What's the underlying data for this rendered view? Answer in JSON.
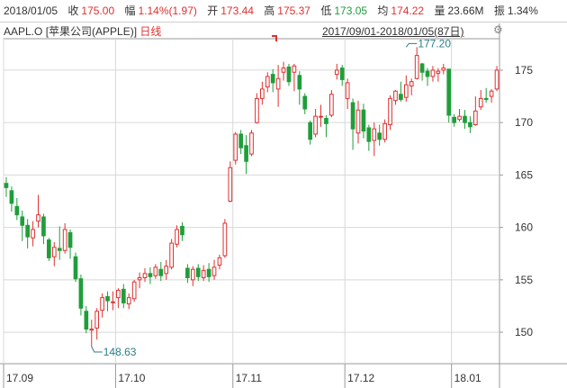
{
  "quote": {
    "date": "2018/01/05",
    "close_label": "收",
    "close": "175.00",
    "change_label": "幅",
    "change": "1.14%(1.97)",
    "open_label": "开",
    "open": "173.44",
    "high_label": "高",
    "high": "175.37",
    "low_label": "低",
    "low": "173.05",
    "avg_label": "均",
    "avg": "174.22",
    "volume_label": "量",
    "volume": "23.66M",
    "amplitude_label": "振",
    "amplitude": "1.34%"
  },
  "header": {
    "symbol": "AAPL.O [苹果公司(APPLE)]",
    "kind": "日线",
    "range": "2017/09/01-2018/01/05(87日)"
  },
  "colors": {
    "up": "#e03030",
    "down": "#1e9e3a",
    "grid": "#d8d8d8",
    "axis": "#999999",
    "annotation": "#2a7d8a"
  },
  "chart_data": {
    "type": "candlestick",
    "ylim": [
      147,
      178
    ],
    "yticks": [
      150,
      155,
      160,
      165,
      170,
      175
    ],
    "xticks": [
      {
        "label": "17.09",
        "index": 0
      },
      {
        "label": "17.10",
        "index": 21
      },
      {
        "label": "17.11",
        "index": 43
      },
      {
        "label": "17.12",
        "index": 64
      },
      {
        "label": "18.01",
        "index": 84
      }
    ],
    "annotations": [
      {
        "label": "148.63",
        "index": 16,
        "value": 148.63
      },
      {
        "label": "177.20",
        "index": 75,
        "value": 177.2
      }
    ],
    "candles": [
      [
        164.2,
        163.8,
        164.8,
        162.9
      ],
      [
        163.5,
        162.3,
        163.9,
        161.5
      ],
      [
        162.0,
        161.2,
        162.8,
        160.7
      ],
      [
        161.0,
        160.2,
        161.6,
        158.7
      ],
      [
        160.2,
        159.1,
        160.8,
        158.0
      ],
      [
        159.0,
        159.8,
        160.6,
        158.2
      ],
      [
        160.6,
        161.2,
        163.1,
        160.0
      ],
      [
        161.0,
        159.2,
        161.3,
        158.4
      ],
      [
        158.8,
        157.1,
        159.0,
        156.8
      ],
      [
        157.2,
        158.1,
        158.6,
        156.3
      ],
      [
        158.0,
        157.8,
        160.1,
        156.9
      ],
      [
        157.8,
        159.8,
        160.4,
        157.5
      ],
      [
        159.5,
        158.1,
        159.8,
        157.0
      ],
      [
        157.2,
        155.1,
        157.6,
        154.8
      ],
      [
        155.1,
        152.3,
        155.5,
        151.6
      ],
      [
        152.0,
        150.3,
        152.5,
        149.9
      ],
      [
        150.2,
        150.3,
        151.2,
        148.63
      ],
      [
        150.4,
        152.0,
        152.3,
        149.3
      ],
      [
        152.1,
        153.3,
        153.7,
        151.4
      ],
      [
        153.4,
        153.0,
        153.9,
        152.0
      ],
      [
        152.9,
        152.9,
        153.9,
        152.1
      ],
      [
        153.3,
        154.0,
        154.2,
        152.3
      ],
      [
        154.1,
        152.8,
        154.6,
        152.3
      ],
      [
        152.7,
        153.3,
        153.7,
        152.2
      ],
      [
        153.2,
        154.8,
        155.0,
        152.9
      ],
      [
        155.0,
        155.2,
        155.7,
        154.2
      ],
      [
        155.2,
        155.6,
        156.1,
        154.8
      ],
      [
        155.6,
        155.3,
        156.2,
        154.6
      ],
      [
        155.4,
        156.2,
        156.5,
        155.1
      ],
      [
        156.0,
        155.4,
        156.7,
        154.9
      ],
      [
        155.6,
        156.3,
        156.9,
        155.0
      ],
      [
        156.2,
        158.5,
        158.9,
        156.0
      ],
      [
        158.4,
        159.8,
        160.2,
        158.1
      ],
      [
        160.1,
        159.3,
        160.5,
        158.7
      ],
      [
        156.1,
        155.2,
        156.5,
        154.7
      ],
      [
        155.0,
        156.0,
        156.3,
        154.4
      ],
      [
        156.1,
        155.3,
        156.5,
        154.9
      ],
      [
        155.2,
        155.9,
        156.4,
        154.9
      ],
      [
        156.0,
        155.3,
        156.6,
        154.8
      ],
      [
        155.4,
        156.2,
        156.9,
        155.0
      ],
      [
        156.4,
        157.1,
        157.4,
        156.0
      ],
      [
        157.3,
        160.4,
        160.8,
        157.1
      ],
      [
        162.5,
        165.7,
        166.3,
        162.4
      ],
      [
        166.4,
        168.9,
        169.1,
        166.0
      ],
      [
        168.9,
        167.6,
        169.3,
        167.0
      ],
      [
        167.8,
        166.3,
        168.8,
        165.1
      ],
      [
        167.0,
        169.0,
        169.3,
        166.8
      ],
      [
        170.0,
        172.3,
        172.8,
        169.9
      ],
      [
        172.3,
        173.2,
        173.9,
        171.7
      ],
      [
        173.4,
        174.4,
        174.8,
        172.9
      ],
      [
        174.6,
        173.8,
        175.1,
        172.9
      ],
      [
        173.2,
        174.2,
        175.5,
        171.5
      ],
      [
        174.8,
        175.2,
        175.8,
        174.0
      ],
      [
        175.3,
        173.9,
        175.6,
        173.5
      ],
      [
        174.8,
        175.4,
        175.6,
        173.0
      ],
      [
        174.5,
        173.2,
        174.9,
        171.7
      ],
      [
        172.5,
        171.3,
        172.8,
        170.8
      ],
      [
        170.0,
        168.4,
        170.2,
        167.9
      ],
      [
        168.9,
        170.6,
        171.3,
        168.6
      ],
      [
        170.6,
        170.6,
        171.7,
        169.6
      ],
      [
        170.4,
        169.9,
        170.7,
        168.6
      ],
      [
        170.7,
        172.7,
        173.1,
        170.5
      ],
      [
        174.6,
        175.0,
        175.6,
        174.1
      ],
      [
        175.2,
        174.1,
        175.5,
        173.5
      ],
      [
        172.3,
        173.8,
        174.2,
        171.3
      ],
      [
        171.9,
        169.4,
        172.3,
        167.4
      ],
      [
        169.0,
        171.2,
        172.1,
        168.0
      ],
      [
        171.2,
        169.2,
        171.8,
        168.5
      ],
      [
        169.5,
        168.2,
        169.8,
        167.3
      ],
      [
        168.3,
        169.4,
        170.0,
        166.8
      ],
      [
        169.0,
        168.4,
        169.8,
        167.8
      ],
      [
        168.4,
        169.9,
        170.3,
        168.1
      ],
      [
        169.8,
        172.3,
        172.6,
        169.3
      ],
      [
        172.1,
        173.0,
        173.1,
        171.7
      ],
      [
        172.7,
        172.2,
        173.9,
        172.0
      ],
      [
        172.4,
        173.6,
        174.5,
        172.0
      ],
      [
        173.5,
        173.9,
        174.2,
        172.6
      ],
      [
        174.2,
        176.4,
        177.2,
        174.1
      ],
      [
        175.6,
        174.8,
        175.7,
        174.0
      ],
      [
        174.9,
        174.4,
        175.2,
        173.5
      ],
      [
        174.4,
        175.0,
        175.4,
        173.9
      ],
      [
        174.7,
        174.9,
        175.2,
        173.9
      ],
      [
        175.0,
        175.2,
        175.6,
        174.6
      ],
      [
        175.1,
        170.7,
        171.8,
        170.0
      ],
      [
        170.5,
        170.0,
        170.8,
        169.6
      ],
      [
        170.3,
        170.6,
        171.3,
        170.1
      ],
      [
        170.6,
        170.0,
        171.2,
        169.4
      ],
      [
        170.0,
        169.6,
        170.6,
        169.0
      ],
      [
        169.8,
        171.1,
        172.5,
        169.7
      ],
      [
        171.5,
        172.3,
        173.1,
        171.2
      ],
      [
        172.3,
        172.2,
        173.3,
        171.9
      ],
      [
        172.5,
        173.0,
        173.2,
        171.9
      ],
      [
        173.2,
        175.0,
        175.4,
        173.0
      ]
    ]
  }
}
